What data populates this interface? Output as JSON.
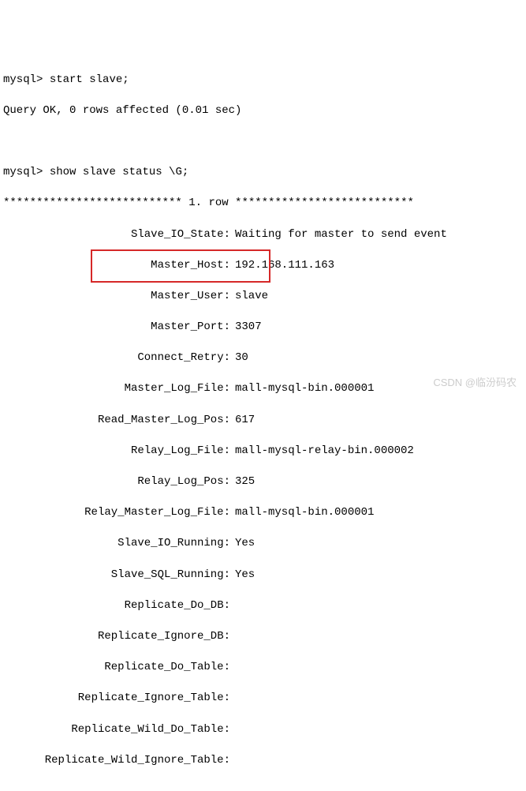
{
  "prompt": "mysql>",
  "commands": {
    "start_slave": "start slave;",
    "show_status": "show slave status \\G;"
  },
  "start_result": "Query OK, 0 rows affected (0.01 sec)",
  "row_header": "*************************** 1. row ***************************",
  "status": {
    "slave_io_state_label": "Slave_IO_State:",
    "slave_io_state": "Waiting for master to send event",
    "master_host_label": "Master_Host:",
    "master_host": "192.168.111.163",
    "master_user_label": "Master_User:",
    "master_user": "slave",
    "master_port_label": "Master_Port:",
    "master_port": "3307",
    "connect_retry_label": "Connect_Retry:",
    "connect_retry": "30",
    "master_log_file_label": "Master_Log_File:",
    "master_log_file": "mall-mysql-bin.000001",
    "read_master_log_pos_label": "Read_Master_Log_Pos:",
    "read_master_log_pos": "617",
    "relay_log_file_label": "Relay_Log_File:",
    "relay_log_file": "mall-mysql-relay-bin.000002",
    "relay_log_pos_label": "Relay_Log_Pos:",
    "relay_log_pos": "325",
    "relay_master_log_file_label": "Relay_Master_Log_File:",
    "relay_master_log_file": "mall-mysql-bin.000001",
    "slave_io_running_label": "Slave_IO_Running:",
    "slave_io_running": "Yes",
    "slave_sql_running_label": "Slave_SQL_Running:",
    "slave_sql_running": "Yes",
    "replicate_do_db_label": "Replicate_Do_DB:",
    "replicate_do_db": "",
    "replicate_ignore_db_label": "Replicate_Ignore_DB:",
    "replicate_ignore_db": "",
    "replicate_do_table_label": "Replicate_Do_Table:",
    "replicate_do_table": "",
    "replicate_ignore_table_label": "Replicate_Ignore_Table:",
    "replicate_ignore_table": "",
    "replicate_wild_do_table_label": "Replicate_Wild_Do_Table:",
    "replicate_wild_do_table": "",
    "replicate_wild_ignore_table_label": "Replicate_Wild_Ignore_Table:",
    "replicate_wild_ignore_table": ""
  },
  "watermark": "CSDN @临汾码农"
}
